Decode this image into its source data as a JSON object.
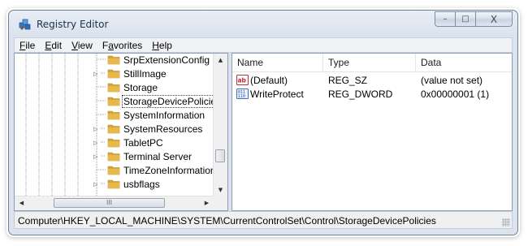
{
  "window": {
    "title": "Registry Editor",
    "icon": "registry-editor-icon"
  },
  "caption_buttons": {
    "minimize": "–",
    "maximize": "□",
    "close": "X"
  },
  "menu": [
    {
      "accel": "F",
      "rest": "ile"
    },
    {
      "accel": "E",
      "rest": "dit"
    },
    {
      "accel": "V",
      "rest": "iew"
    },
    {
      "pre": "F",
      "accel": "a",
      "rest": "vorites"
    },
    {
      "accel": "H",
      "rest": "elp"
    }
  ],
  "tree": {
    "items": [
      {
        "label": "SrpExtensionConfig",
        "expandable": false,
        "selected": false
      },
      {
        "label": "StillImage",
        "expandable": true,
        "selected": false
      },
      {
        "label": "Storage",
        "expandable": false,
        "selected": false
      },
      {
        "label": "StorageDevicePolicies",
        "expandable": false,
        "selected": true
      },
      {
        "label": "SystemInformation",
        "expandable": false,
        "selected": false
      },
      {
        "label": "SystemResources",
        "expandable": true,
        "selected": false
      },
      {
        "label": "TabletPC",
        "expandable": true,
        "selected": false
      },
      {
        "label": "Terminal Server",
        "expandable": true,
        "selected": false
      },
      {
        "label": "TimeZoneInformation",
        "expandable": false,
        "selected": false
      },
      {
        "label": "usbflags",
        "expandable": true,
        "selected": false
      }
    ],
    "hscroll_grip": "III"
  },
  "list": {
    "columns": {
      "name": "Name",
      "type": "Type",
      "data": "Data"
    },
    "rows": [
      {
        "icon": "string-value-icon",
        "name": "(Default)",
        "type": "REG_SZ",
        "data": "(value not set)"
      },
      {
        "icon": "binary-value-icon",
        "name": "WriteProtect",
        "type": "REG_DWORD",
        "data": "0x00000001 (1)"
      }
    ]
  },
  "status": {
    "path": "Computer\\HKEY_LOCAL_MACHINE\\SYSTEM\\CurrentControlSet\\Control\\StorageDevicePolicies"
  },
  "colors": {
    "folder": "#e8b84a",
    "window_frame": "#dbe3ee",
    "border": "#8e9db0"
  }
}
